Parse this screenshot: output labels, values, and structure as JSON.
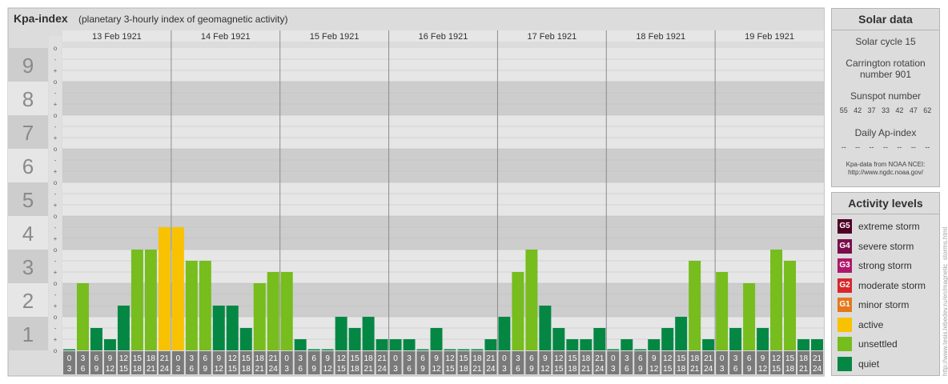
{
  "header": {
    "title": "Kpa-index",
    "subtitle": "(planetary 3-hourly index of geomagnetic activity)"
  },
  "chart_data": {
    "type": "bar",
    "title": "Kpa-index",
    "subtitle": "(planetary 3-hourly index of geomagnetic activity)",
    "ylim": [
      0,
      9
    ],
    "y_major_ticks": [
      "0",
      "1",
      "2",
      "3",
      "4",
      "5",
      "6",
      "7",
      "8",
      "9"
    ],
    "y_minor_labels": [
      "o",
      "+",
      "-"
    ],
    "days": [
      "13 Feb 1921",
      "14 Feb 1921",
      "15 Feb 1921",
      "16 Feb 1921",
      "17 Feb 1921",
      "18 Feb 1921",
      "19 Feb 1921"
    ],
    "hour_top": [
      "0",
      "3",
      "6",
      "9",
      "12",
      "15",
      "18",
      "21"
    ],
    "hour_bottom": [
      "3",
      "6",
      "9",
      "12",
      "15",
      "18",
      "21",
      "24"
    ],
    "values": [
      [
        0.0,
        2.0,
        0.667,
        0.333,
        1.333,
        3.0,
        3.0,
        3.667
      ],
      [
        3.667,
        2.667,
        2.667,
        1.333,
        1.333,
        0.667,
        2.0,
        2.333
      ],
      [
        2.333,
        0.333,
        0.0,
        0.0,
        1.0,
        0.667,
        1.0,
        0.333
      ],
      [
        0.333,
        0.333,
        0.0,
        0.667,
        0.0,
        0.0,
        0.0,
        0.333
      ],
      [
        1.0,
        2.333,
        3.0,
        1.333,
        0.667,
        0.333,
        0.333,
        0.667
      ],
      [
        0.0,
        0.333,
        0.0,
        0.333,
        0.667,
        1.0,
        2.667,
        0.333
      ],
      [
        2.333,
        0.667,
        2.0,
        0.667,
        3.0,
        2.667,
        0.333,
        0.333
      ]
    ],
    "colors": {
      "quiet": "#058744",
      "unsettled": "#76bd1d",
      "active": "#f8c201"
    }
  },
  "solar": {
    "title": "Solar data",
    "cycle": "Solar cycle 15",
    "carrington_line1": "Carrington rotation",
    "carrington_line2": "number 901",
    "sunspot_label": "Sunspot number",
    "sunspots": [
      "55",
      "42",
      "37",
      "33",
      "42",
      "47",
      "62"
    ],
    "ap_label": "Daily Ap-index",
    "ap": [
      "--",
      "--",
      "--",
      "--",
      "--",
      "--",
      "--"
    ],
    "source_line1": "Kpa-data from NOAA NCEI:",
    "source_line2": "http://www.ngdc.noaa.gov/"
  },
  "activity": {
    "title": "Activity levels",
    "levels": [
      {
        "code": "G5",
        "label": "extreme storm",
        "color": "#4d0026"
      },
      {
        "code": "G4",
        "label": "severe storm",
        "color": "#7a0d4b"
      },
      {
        "code": "G3",
        "label": "strong storm",
        "color": "#b0176b"
      },
      {
        "code": "G2",
        "label": "moderate storm",
        "color": "#d9262b"
      },
      {
        "code": "G1",
        "label": "minor storm",
        "color": "#e4781c"
      },
      {
        "code": "",
        "label": "active",
        "color": "#f8c201"
      },
      {
        "code": "",
        "label": "unsettled",
        "color": "#76bd1d"
      },
      {
        "code": "",
        "label": "quiet",
        "color": "#058744"
      }
    ]
  },
  "watermark": "http://www.tesis.lebedev.ru/en/magnetic_storms.html"
}
